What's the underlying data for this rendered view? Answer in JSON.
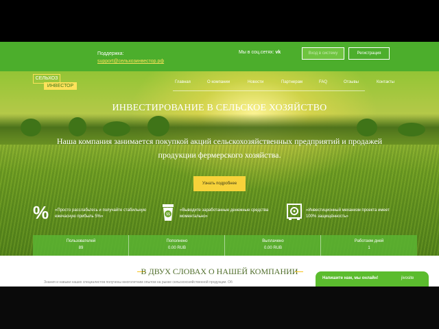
{
  "topbar": {
    "support_label": "Поддержка:",
    "support_email": "support@сельхозинвестор.рф",
    "social_label": "Мы в соц.сетях:",
    "social_icon": "vk-icon",
    "login_label": "Вход в систему",
    "register_label": "Регистрация"
  },
  "logo": {
    "line1": "СЕЛЬХОЗ",
    "line2": "ИНВЕСТОР"
  },
  "nav": {
    "items": [
      "Главная",
      "О компании",
      "Новости",
      "Партнерам",
      "FAQ",
      "Отзывы",
      "Контакты"
    ]
  },
  "hero": {
    "title": "ИНВЕСТИРОВАНИЕ В СЕЛЬСКОЕ ХОЗЯЙСТВО",
    "line1": "Наша компания занимается покупкой акций сельскохозяйственных предприятий и продажей",
    "line2": "продукции фермерского хозяйства.",
    "button": "Узнать подробнее"
  },
  "features": [
    {
      "icon": "percent-icon",
      "line1": "«Просто расслабьтесь и получайте стабильную",
      "line2": "ежечасную прибыль 5%»"
    },
    {
      "icon": "coffee-cup-icon",
      "line1": "«Выводите заработанные денежные средства",
      "line2": "моментально»"
    },
    {
      "icon": "safe-icon",
      "line1": "«Инвестиционный механизм проекта имеет",
      "line2": "100% защищённость»"
    }
  ],
  "stats": [
    {
      "label": "Пользователей",
      "value": "89"
    },
    {
      "label": "Пополнено",
      "value": "0.00 RUB"
    },
    {
      "label": "Выплачено",
      "value": "0.00 RUB"
    },
    {
      "label": "Работаем дней",
      "value": "1"
    }
  ],
  "about": {
    "title": "В ДВУХ СЛОВАХ О НАШЕЙ КОМПАНИИ",
    "text": "Знания и навыки наших специалистов получены многолетним опытом на рынке сельскохозяйственной продукции. Об"
  },
  "chat": {
    "label": "Напишите нам, мы онлайн!",
    "brand": "jivosite"
  },
  "colors": {
    "green": "#4cae2c",
    "yellow": "#f7d23a",
    "accent": "#ffe25a"
  }
}
